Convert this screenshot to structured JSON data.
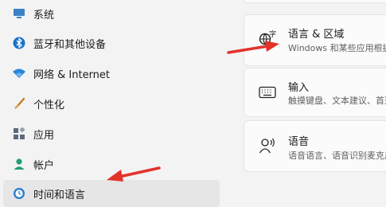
{
  "sidebar": {
    "items": [
      {
        "label": "系统",
        "icon": "system-icon"
      },
      {
        "label": "蓝牙和其他设备",
        "icon": "bluetooth-icon"
      },
      {
        "label": "网络 & Internet",
        "icon": "wifi-icon"
      },
      {
        "label": "个性化",
        "icon": "brush-icon"
      },
      {
        "label": "应用",
        "icon": "apps-icon"
      },
      {
        "label": "帐户",
        "icon": "account-icon"
      },
      {
        "label": "时间和语言",
        "icon": "clock-globe-icon",
        "selected": true
      }
    ]
  },
  "main": {
    "cards": [
      {
        "title": "语言 & 区域",
        "subtitle": "Windows 和某些应用根据",
        "icon": "language-region-icon"
      },
      {
        "title": "输入",
        "subtitle": "触摸键盘、文本建议、首选",
        "icon": "keyboard-icon"
      },
      {
        "title": "语音",
        "subtitle": "语音语言、语音识别麦克风",
        "icon": "speech-icon"
      }
    ]
  },
  "colors": {
    "accent": "#0067c0",
    "annotation_arrow": "#e2332b",
    "background": "#f3f3f3",
    "card": "#fbfbfb"
  }
}
